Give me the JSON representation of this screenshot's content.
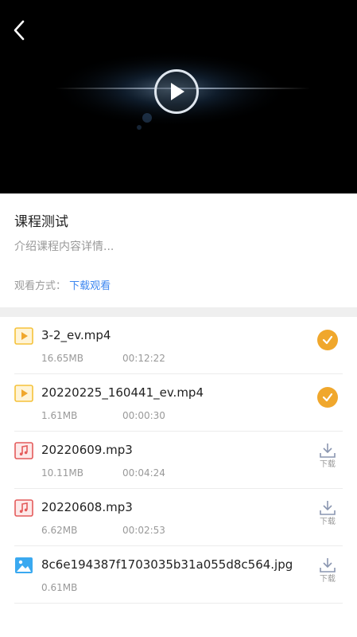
{
  "player": {
    "back_icon": "chevron-left-icon",
    "play_icon": "play-icon"
  },
  "course": {
    "title": "课程测试",
    "description": "介绍课程内容详情...",
    "watch_label": "观看方式：",
    "watch_value": "下载观看"
  },
  "colors": {
    "accent_blue": "#3d87f0",
    "done_orange": "#f0a72c",
    "video_icon": "#f5c23a",
    "audio_icon": "#e45b5b",
    "image_icon": "#3aa9f0"
  },
  "files": [
    {
      "type": "video",
      "icon": "video-file-icon",
      "name": "3-2_ev.mp4",
      "size": "16.65MB",
      "duration": "00:12:22",
      "status": "downloaded"
    },
    {
      "type": "video",
      "icon": "video-file-icon",
      "name": "20220225_160441_ev.mp4",
      "size": "1.61MB",
      "duration": "00:00:30",
      "status": "downloaded"
    },
    {
      "type": "audio",
      "icon": "audio-file-icon",
      "name": "20220609.mp3",
      "size": "10.11MB",
      "duration": "00:04:24",
      "status": "download",
      "download_label": "下载"
    },
    {
      "type": "audio",
      "icon": "audio-file-icon",
      "name": "20220608.mp3",
      "size": "6.62MB",
      "duration": "00:02:53",
      "status": "download",
      "download_label": "下载"
    },
    {
      "type": "image",
      "icon": "image-file-icon",
      "name": "8c6e194387f1703035b31a055d8c564.jpg",
      "size": "0.61MB",
      "duration": "",
      "status": "download",
      "download_label": "下载"
    }
  ]
}
